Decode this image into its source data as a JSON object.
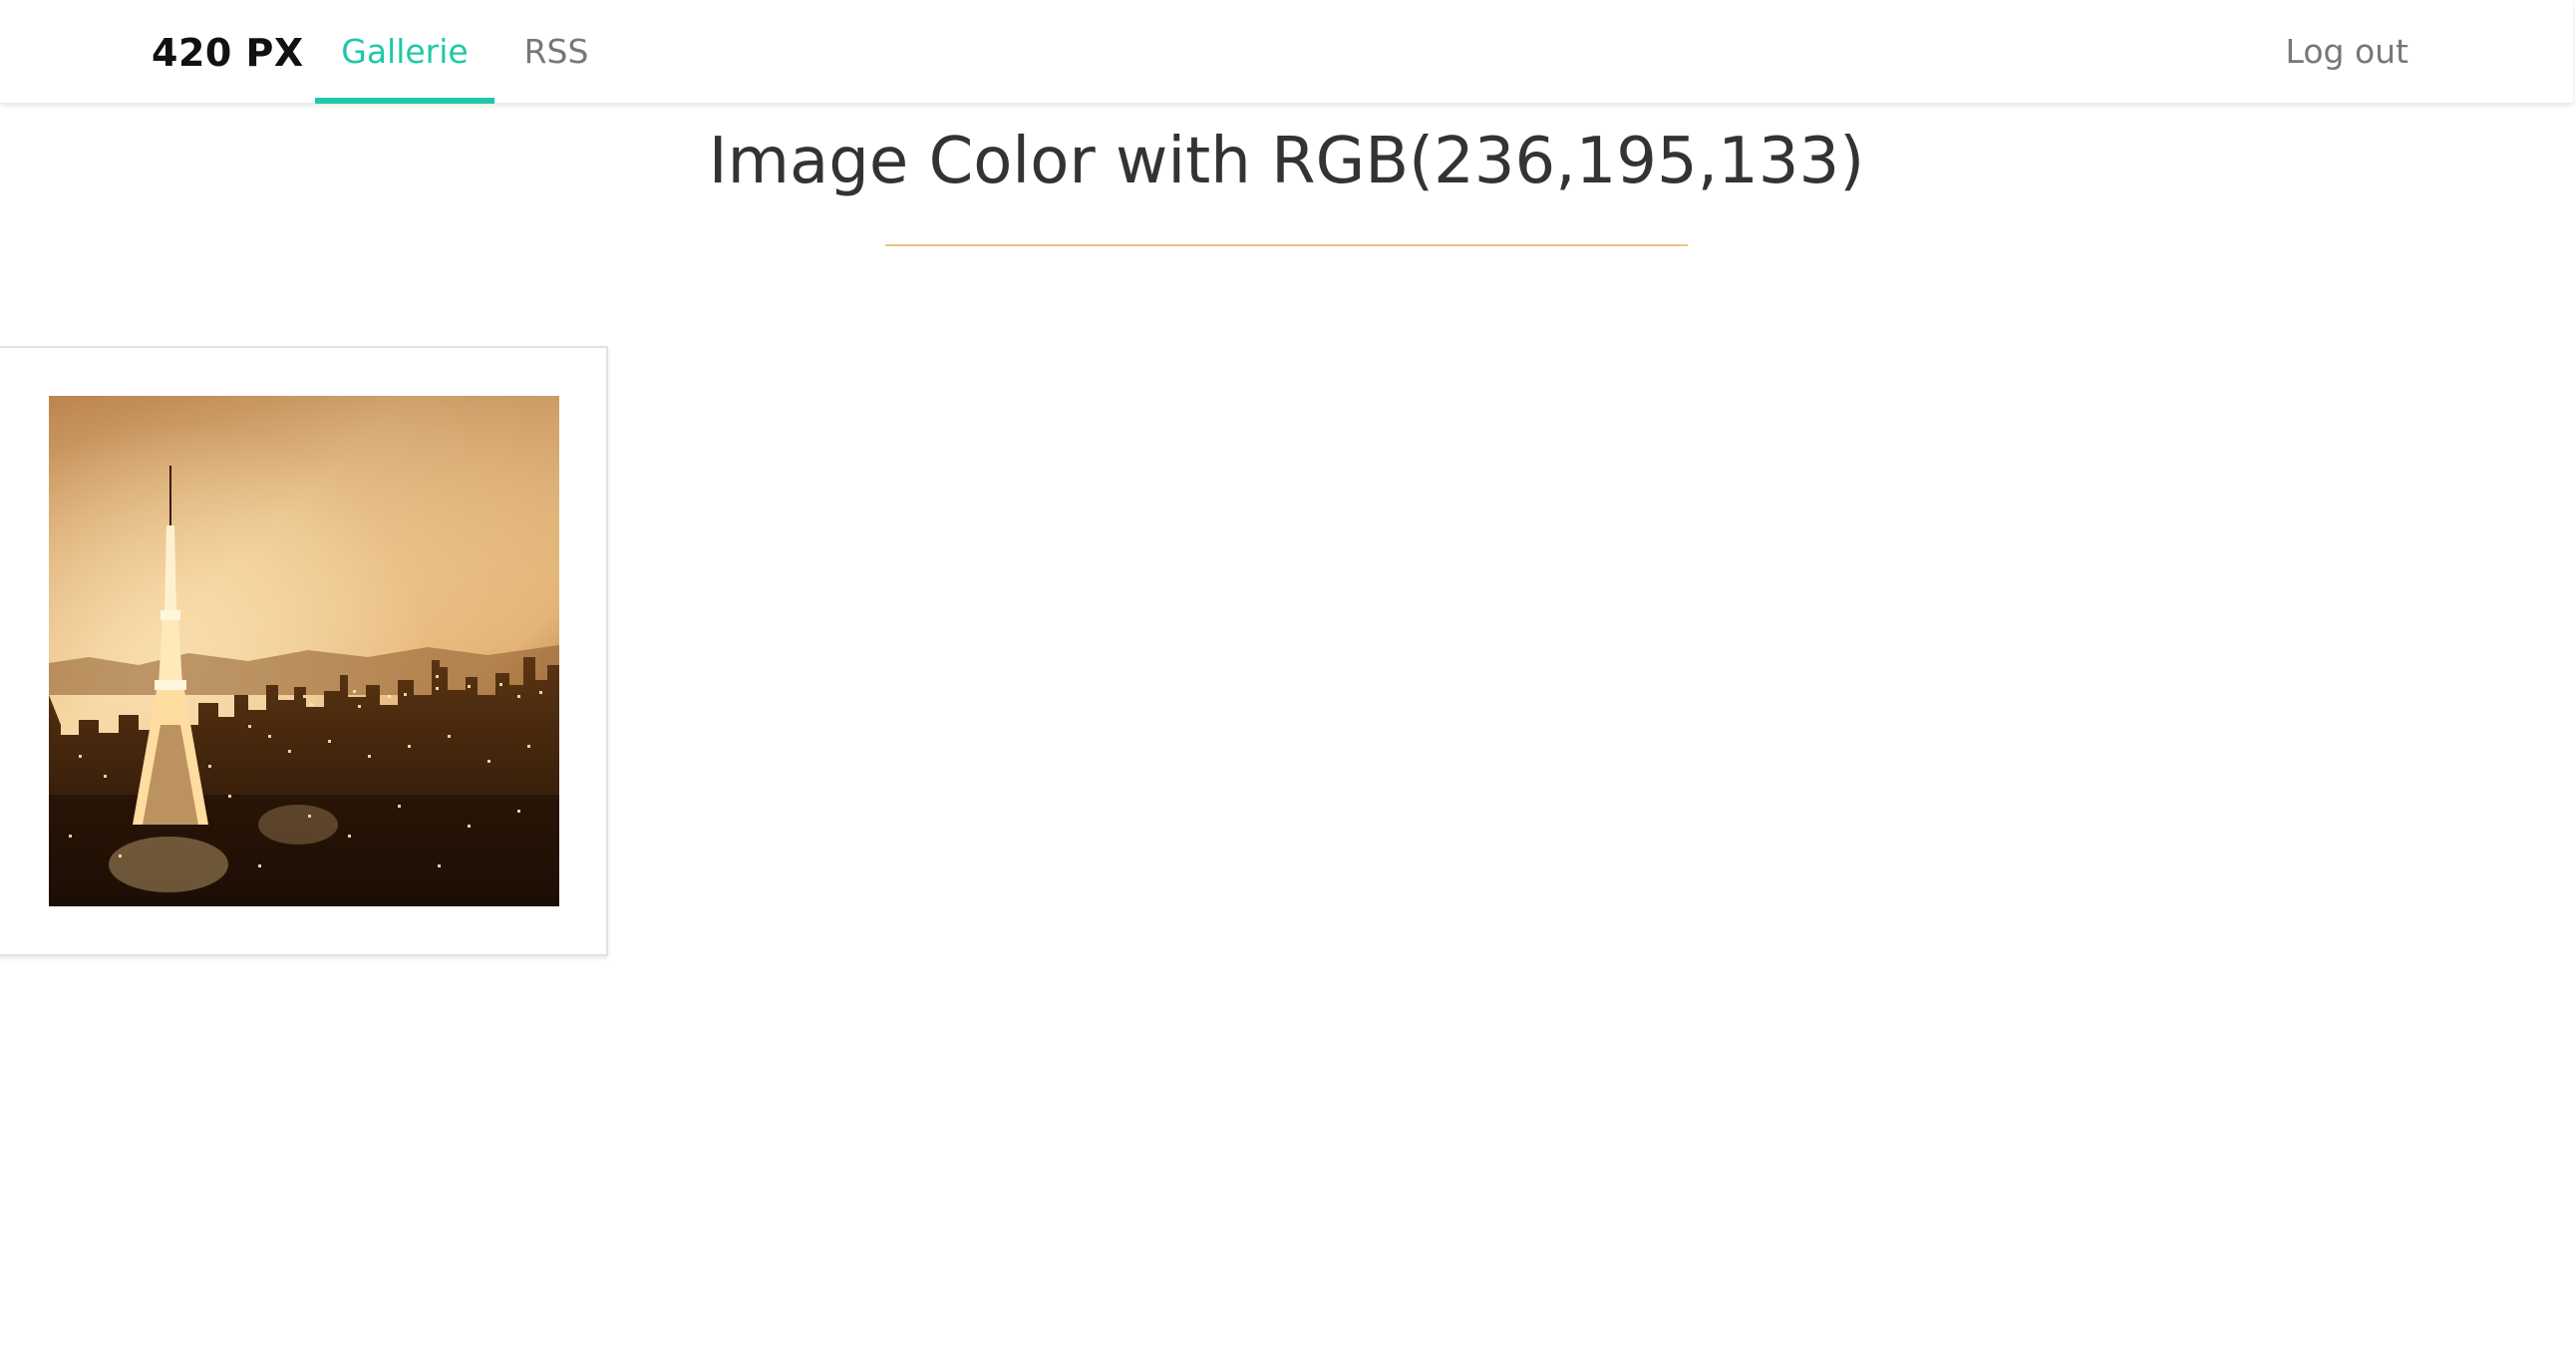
{
  "navbar": {
    "brand": "420 PX",
    "tabs": [
      {
        "label": "Gallerie",
        "active": true
      },
      {
        "label": "RSS",
        "active": false
      }
    ],
    "logout_label": "Log out"
  },
  "page": {
    "title": "Image Color with RGB(236,195,133)"
  },
  "gallery": {
    "items": [
      {
        "subject": "sepia-toned night city skyline with illuminated tower"
      }
    ]
  },
  "colors": {
    "accent": "#1fc8a8",
    "divider": "#ecc385",
    "filter_rgb": "#ecc385",
    "text_dark": "#333333",
    "text_muted": "#777777"
  }
}
